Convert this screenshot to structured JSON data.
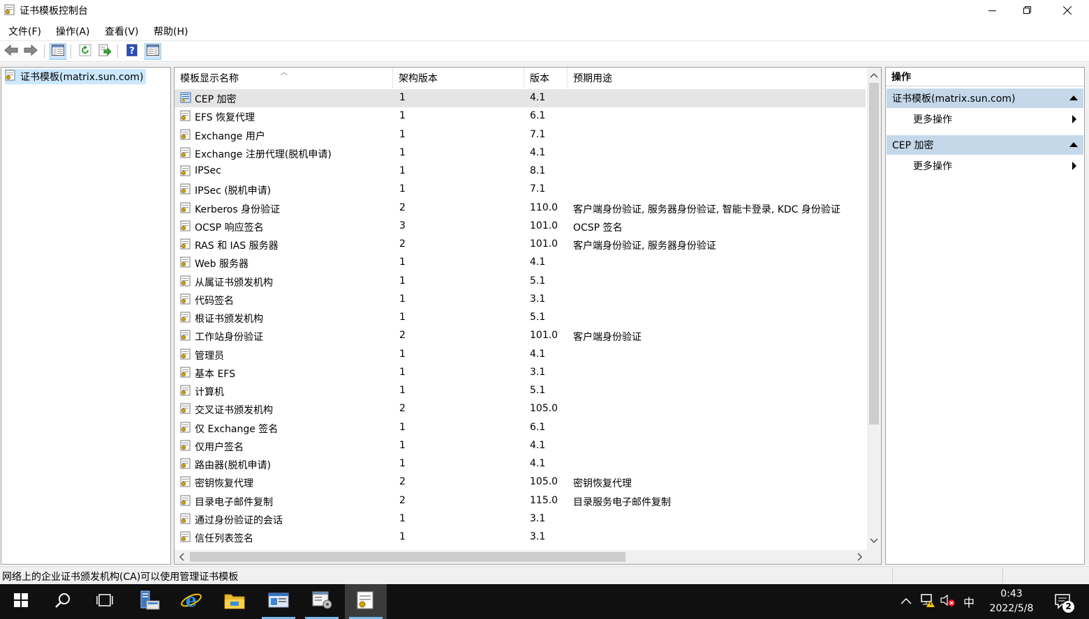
{
  "window": {
    "title": "证书模板控制台",
    "icons": {
      "app": "certificate-template-icon",
      "minimize": "minimize-icon",
      "maximize": "maximize-icon",
      "close": "close-icon"
    }
  },
  "menu": [
    {
      "label": "文件(F)"
    },
    {
      "label": "操作(A)"
    },
    {
      "label": "查看(V)"
    },
    {
      "label": "帮助(H)"
    }
  ],
  "toolbar": [
    {
      "icon": "back-arrow-icon"
    },
    {
      "icon": "forward-arrow-icon"
    },
    {
      "icon": "show-hide-console-tree-icon",
      "pressed": true
    },
    {
      "icon": "refresh-icon"
    },
    {
      "icon": "export-list-icon"
    },
    {
      "icon": "help-icon"
    },
    {
      "icon": "show-hide-action-pane-icon",
      "pressed": true
    }
  ],
  "tree": {
    "root_label": "证书模板(matrix.sun.com)"
  },
  "table": {
    "columns": [
      "模板显示名称",
      "架构版本",
      "版本",
      "预期用途"
    ],
    "rows": [
      {
        "name": "CEP 加密",
        "schema": "1",
        "version": "4.1",
        "purpose": ""
      },
      {
        "name": "EFS 恢复代理",
        "schema": "1",
        "version": "6.1",
        "purpose": ""
      },
      {
        "name": "Exchange 用户",
        "schema": "1",
        "version": "7.1",
        "purpose": ""
      },
      {
        "name": "Exchange 注册代理(脱机申请)",
        "schema": "1",
        "version": "4.1",
        "purpose": ""
      },
      {
        "name": "IPSec",
        "schema": "1",
        "version": "8.1",
        "purpose": ""
      },
      {
        "name": "IPSec (脱机申请)",
        "schema": "1",
        "version": "7.1",
        "purpose": ""
      },
      {
        "name": "Kerberos 身份验证",
        "schema": "2",
        "version": "110.0",
        "purpose": "客户端身份验证, 服务器身份验证, 智能卡登录, KDC 身份验证"
      },
      {
        "name": "OCSP 响应签名",
        "schema": "3",
        "version": "101.0",
        "purpose": "OCSP 签名"
      },
      {
        "name": "RAS 和 IAS 服务器",
        "schema": "2",
        "version": "101.0",
        "purpose": "客户端身份验证, 服务器身份验证"
      },
      {
        "name": "Web 服务器",
        "schema": "1",
        "version": "4.1",
        "purpose": ""
      },
      {
        "name": "从属证书颁发机构",
        "schema": "1",
        "version": "5.1",
        "purpose": ""
      },
      {
        "name": "代码签名",
        "schema": "1",
        "version": "3.1",
        "purpose": ""
      },
      {
        "name": "根证书颁发机构",
        "schema": "1",
        "version": "5.1",
        "purpose": ""
      },
      {
        "name": "工作站身份验证",
        "schema": "2",
        "version": "101.0",
        "purpose": "客户端身份验证"
      },
      {
        "name": "管理员",
        "schema": "1",
        "version": "4.1",
        "purpose": ""
      },
      {
        "name": "基本 EFS",
        "schema": "1",
        "version": "3.1",
        "purpose": ""
      },
      {
        "name": "计算机",
        "schema": "1",
        "version": "5.1",
        "purpose": ""
      },
      {
        "name": "交叉证书颁发机构",
        "schema": "2",
        "version": "105.0",
        "purpose": ""
      },
      {
        "name": "仅 Exchange 签名",
        "schema": "1",
        "version": "6.1",
        "purpose": ""
      },
      {
        "name": "仅用户签名",
        "schema": "1",
        "version": "4.1",
        "purpose": ""
      },
      {
        "name": "路由器(脱机申请)",
        "schema": "1",
        "version": "4.1",
        "purpose": ""
      },
      {
        "name": "密钥恢复代理",
        "schema": "2",
        "version": "105.0",
        "purpose": "密钥恢复代理"
      },
      {
        "name": "目录电子邮件复制",
        "schema": "2",
        "version": "115.0",
        "purpose": "目录服务电子邮件复制"
      },
      {
        "name": "通过身份验证的会话",
        "schema": "1",
        "version": "3.1",
        "purpose": ""
      },
      {
        "name": "信任列表签名",
        "schema": "1",
        "version": "3.1",
        "purpose": ""
      }
    ],
    "selected_index": 0,
    "sort_icon": "sort-ascending-icon"
  },
  "actions": {
    "title": "操作",
    "sections": [
      {
        "label": "证书模板(matrix.sun.com)",
        "items": [
          "更多操作"
        ]
      },
      {
        "label": "CEP 加密",
        "items": [
          "更多操作"
        ]
      }
    ]
  },
  "status": {
    "text": "网络上的企业证书颁发机构(CA)可以使用管理证书模板"
  },
  "taskbar": {
    "buttons": [
      {
        "icon": "start-windows-icon"
      },
      {
        "icon": "search-icon"
      },
      {
        "icon": "task-view-icon"
      },
      {
        "icon": "server-manager-icon"
      },
      {
        "icon": "internet-explorer-icon"
      },
      {
        "icon": "file-explorer-icon"
      },
      {
        "icon": "certification-authority-icon"
      },
      {
        "icon": "mmc-console-icon"
      },
      {
        "icon": "certificate-templates-console-icon"
      }
    ],
    "tray": {
      "ime": "中",
      "time": "0:43",
      "date": "2022/5/8",
      "notification_count": "2"
    }
  },
  "colors": {
    "selection": "#cce8ff",
    "row_selected": "#e5e5e5",
    "action_section": "#c4d8ea",
    "taskbar": "#101010",
    "taskbar_accent": "#76b9ed"
  }
}
